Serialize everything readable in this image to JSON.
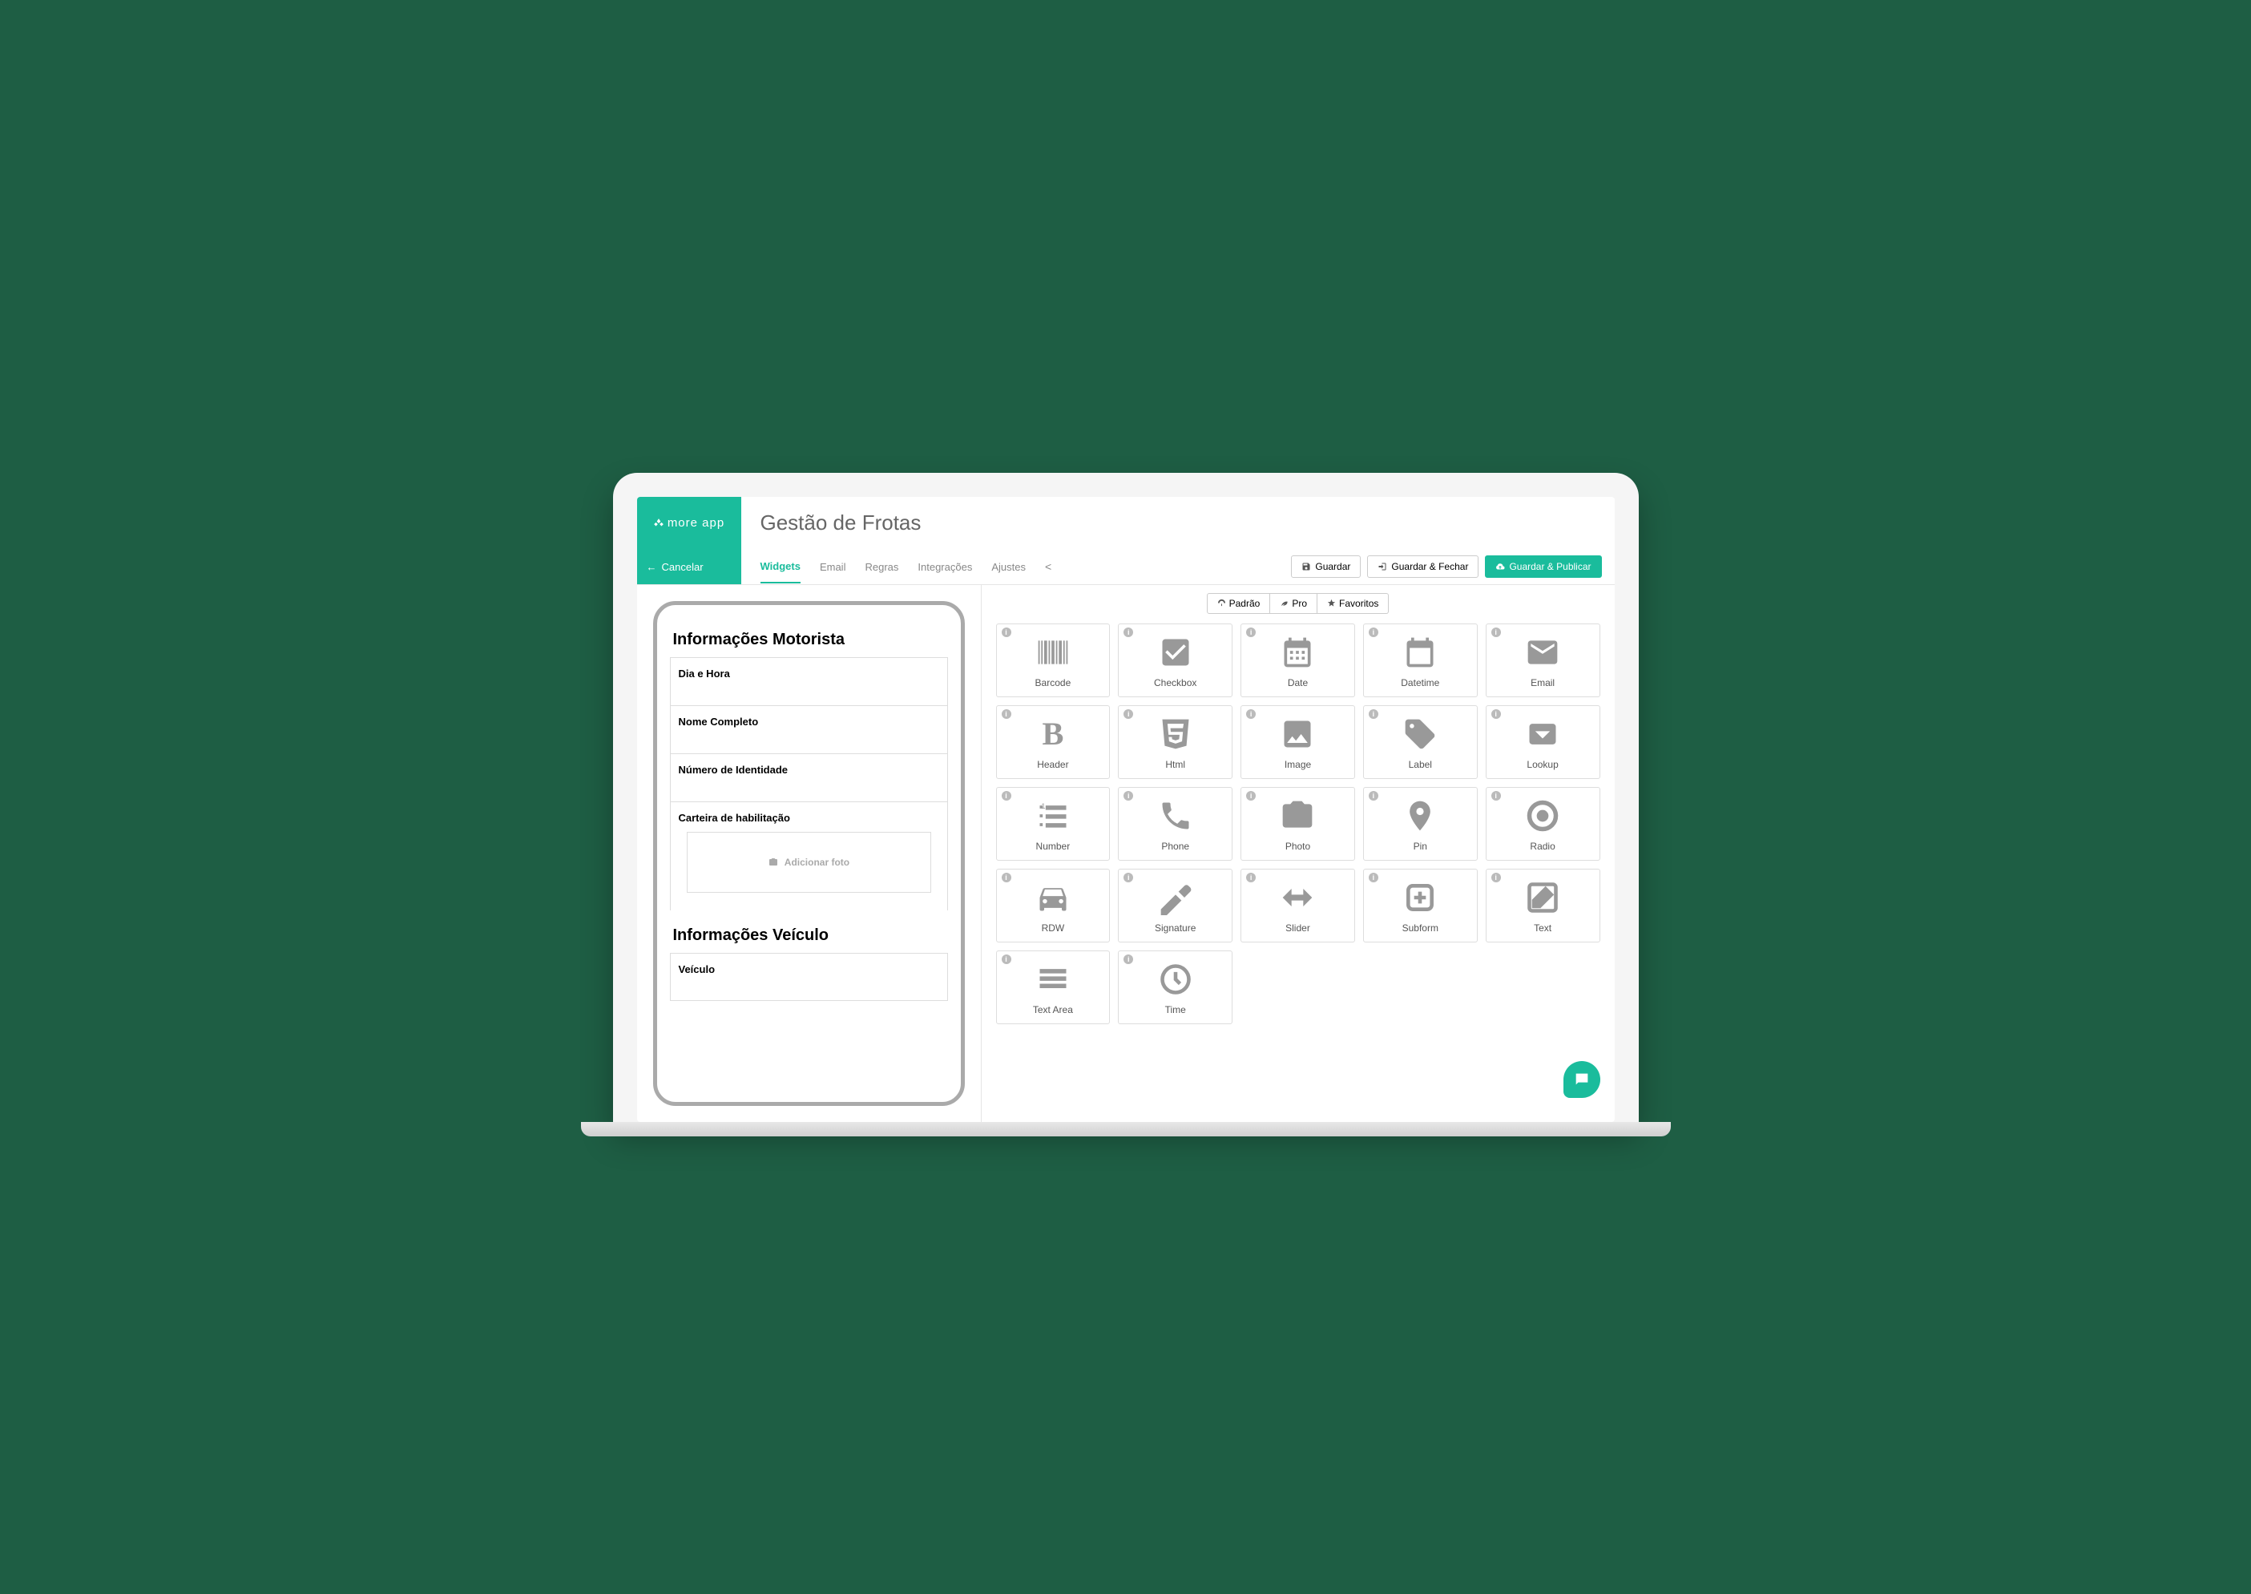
{
  "brand": "more app",
  "page_title": "Gestão de Frotas",
  "cancel": "Cancelar",
  "tabs": [
    "Widgets",
    "Email",
    "Regras",
    "Integrações",
    "Ajustes"
  ],
  "active_tab": 0,
  "actions": {
    "save": "Guardar",
    "save_close": "Guardar & Fechar",
    "save_publish": "Guardar & Publicar"
  },
  "preview": {
    "section1_title": "Informações Motorista",
    "fields1": [
      "Dia e Hora",
      "Nome Completo",
      "Número de Identidade",
      "Carteira de habilitação"
    ],
    "photo_label": "Adicionar foto",
    "section2_title": "Informações Veículo",
    "fields2": [
      "Veículo"
    ]
  },
  "filter_tabs": [
    "Padrão",
    "Pro",
    "Favoritos"
  ],
  "widgets": [
    {
      "label": "Barcode",
      "icon": "barcode"
    },
    {
      "label": "Checkbox",
      "icon": "checkbox"
    },
    {
      "label": "Date",
      "icon": "date"
    },
    {
      "label": "Datetime",
      "icon": "datetime"
    },
    {
      "label": "Email",
      "icon": "email"
    },
    {
      "label": "Header",
      "icon": "header"
    },
    {
      "label": "Html",
      "icon": "html"
    },
    {
      "label": "Image",
      "icon": "image"
    },
    {
      "label": "Label",
      "icon": "label"
    },
    {
      "label": "Lookup",
      "icon": "lookup"
    },
    {
      "label": "Number",
      "icon": "number"
    },
    {
      "label": "Phone",
      "icon": "phone"
    },
    {
      "label": "Photo",
      "icon": "photo"
    },
    {
      "label": "Pin",
      "icon": "pin"
    },
    {
      "label": "Radio",
      "icon": "radio"
    },
    {
      "label": "RDW",
      "icon": "rdw"
    },
    {
      "label": "Signature",
      "icon": "signature"
    },
    {
      "label": "Slider",
      "icon": "slider"
    },
    {
      "label": "Subform",
      "icon": "subform"
    },
    {
      "label": "Text",
      "icon": "text"
    },
    {
      "label": "Text Area",
      "icon": "textarea"
    },
    {
      "label": "Time",
      "icon": "time"
    }
  ]
}
